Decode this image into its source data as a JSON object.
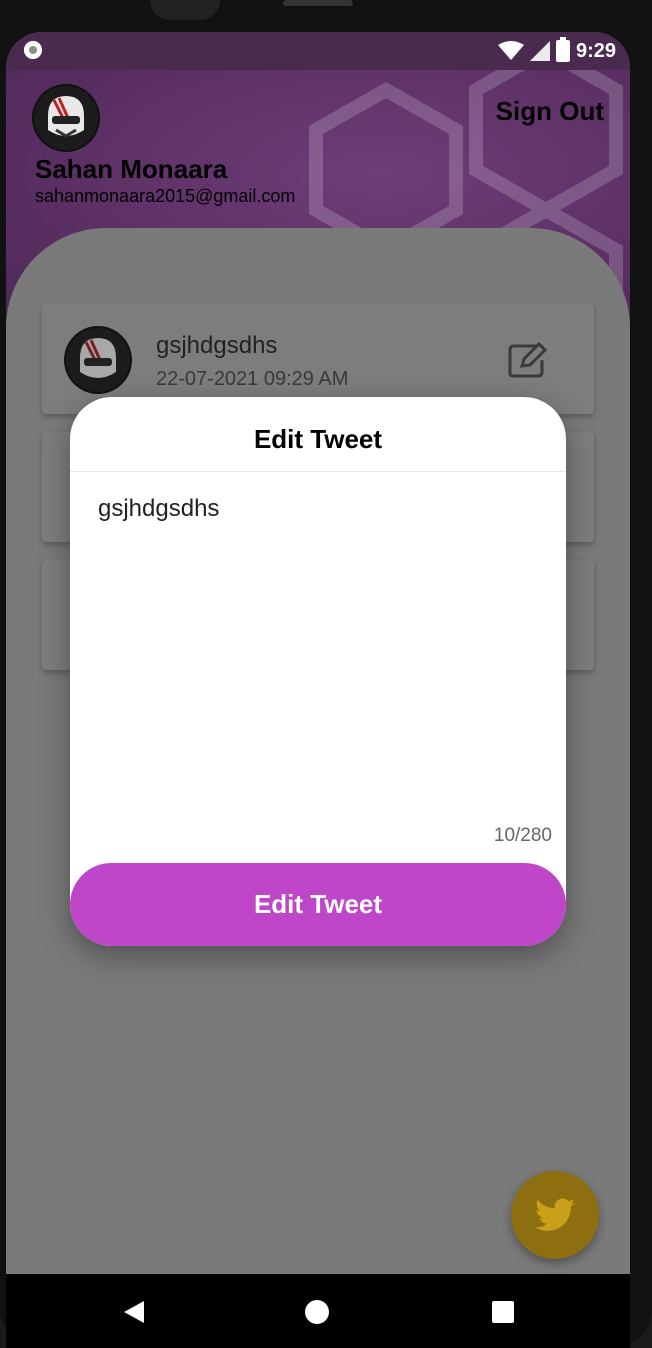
{
  "status_bar": {
    "time": "9:29",
    "icons": [
      "notification-dot-icon",
      "wifi-icon",
      "signal-icon",
      "battery-icon"
    ]
  },
  "header": {
    "name": "Sahan Monaara",
    "email": "sahanmonaara2015@gmail.com",
    "sign_out_label": "Sign Out"
  },
  "tweets": [
    {
      "text": "gsjhdgsdhs",
      "timestamp": "22-07-2021 09:29 AM",
      "edit_icon": "edit-icon"
    }
  ],
  "modal": {
    "title": "Edit Tweet",
    "input_value": "gsjhdgsdhs",
    "char_count": "10/280",
    "button_label": "Edit Tweet"
  },
  "fab": {
    "icon": "twitter-bird-icon"
  },
  "colors": {
    "accent": "#bf45c9",
    "header_purple": "#5b2f64",
    "fab_gold": "#8d6f10",
    "overlay_gray": "#7a7a7a"
  },
  "nav": {
    "icons": [
      "back-icon",
      "home-icon",
      "recents-icon"
    ]
  }
}
